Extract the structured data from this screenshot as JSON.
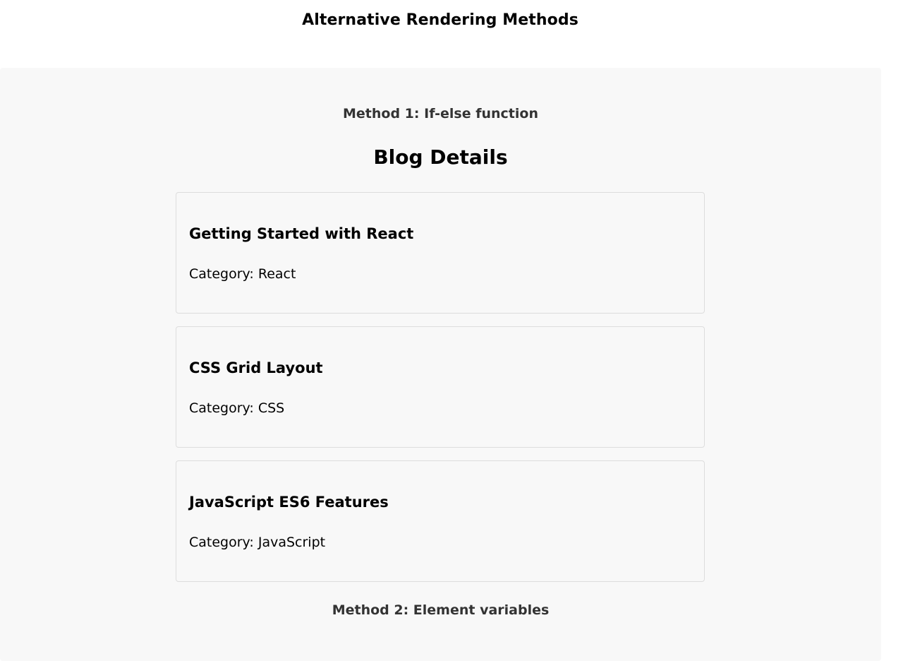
{
  "page": {
    "title": "Alternative Rendering Methods"
  },
  "section1": {
    "method_label": "Method 1: If-else function",
    "heading": "Blog Details",
    "posts": [
      {
        "title": "Getting Started with React",
        "category": "Category: React"
      },
      {
        "title": "CSS Grid Layout",
        "category": "Category: CSS"
      },
      {
        "title": "JavaScript ES6 Features",
        "category": "Category: JavaScript"
      }
    ]
  },
  "section2": {
    "method_label": "Method 2: Element variables"
  },
  "colors": {
    "panel_background": "#f8f8f8",
    "card_border": "#dddddd",
    "method_label_text": "#333333"
  }
}
